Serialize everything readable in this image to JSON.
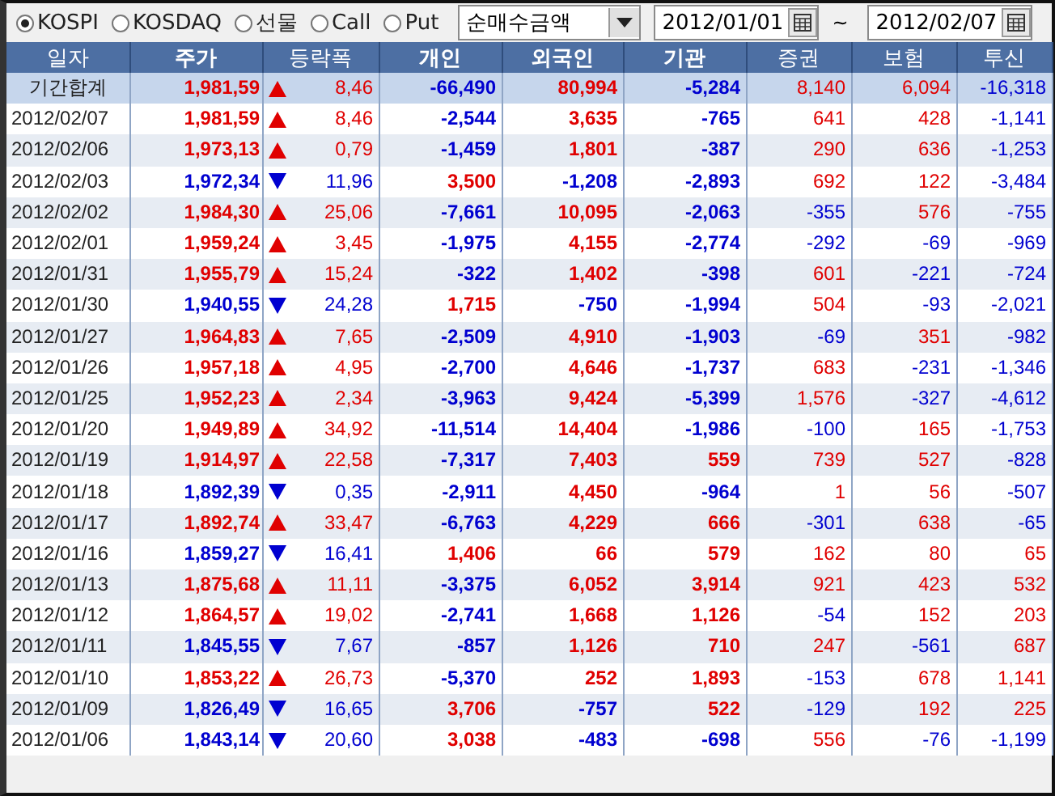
{
  "market_options": [
    {
      "label": "KOSPI",
      "selected": true
    },
    {
      "label": "KOSDAQ",
      "selected": false
    },
    {
      "label": "선물",
      "selected": false
    },
    {
      "label": "Call",
      "selected": false
    },
    {
      "label": "Put",
      "selected": false
    }
  ],
  "value_type": {
    "value": "순매수금액"
  },
  "date_from": {
    "value": "2012/01/01"
  },
  "date_range_separator": "~",
  "date_to": {
    "value": "2012/02/07"
  },
  "table": {
    "columns": [
      "일자",
      "주가",
      "등락폭",
      "개인",
      "외국인",
      "기관",
      "증권",
      "보험",
      "투신"
    ],
    "rows": [
      {
        "kind": "total",
        "rising": true,
        "cells": [
          "기간합계",
          "1,981,59",
          "8,46",
          "-66,490",
          "80,994",
          "-5,284",
          "8,140",
          "6,094",
          "-16,318"
        ]
      },
      {
        "kind": "day",
        "rising": true,
        "cells": [
          "2012/02/07",
          "1,981,59",
          "8,46",
          "-2,544",
          "3,635",
          "-765",
          "641",
          "428",
          "-1,141"
        ]
      },
      {
        "kind": "day",
        "rising": true,
        "cells": [
          "2012/02/06",
          "1,973,13",
          "0,79",
          "-1,459",
          "1,801",
          "-387",
          "290",
          "636",
          "-1,253"
        ]
      },
      {
        "kind": "day",
        "rising": false,
        "cells": [
          "2012/02/03",
          "1,972,34",
          "11,96",
          "3,500",
          "-1,208",
          "-2,893",
          "692",
          "122",
          "-3,484"
        ]
      },
      {
        "kind": "day",
        "rising": true,
        "cells": [
          "2012/02/02",
          "1,984,30",
          "25,06",
          "-7,661",
          "10,095",
          "-2,063",
          "-355",
          "576",
          "-755"
        ]
      },
      {
        "kind": "day",
        "rising": true,
        "cells": [
          "2012/02/01",
          "1,959,24",
          "3,45",
          "-1,975",
          "4,155",
          "-2,774",
          "-292",
          "-69",
          "-969"
        ]
      },
      {
        "kind": "day",
        "rising": true,
        "cells": [
          "2012/01/31",
          "1,955,79",
          "15,24",
          "-322",
          "1,402",
          "-398",
          "601",
          "-221",
          "-724"
        ]
      },
      {
        "kind": "day",
        "rising": false,
        "cells": [
          "2012/01/30",
          "1,940,55",
          "24,28",
          "1,715",
          "-750",
          "-1,994",
          "504",
          "-93",
          "-2,021"
        ]
      },
      {
        "kind": "day",
        "rising": true,
        "cells": [
          "2012/01/27",
          "1,964,83",
          "7,65",
          "-2,509",
          "4,910",
          "-1,903",
          "-69",
          "351",
          "-982"
        ]
      },
      {
        "kind": "day",
        "rising": true,
        "cells": [
          "2012/01/26",
          "1,957,18",
          "4,95",
          "-2,700",
          "4,646",
          "-1,737",
          "683",
          "-231",
          "-1,346"
        ]
      },
      {
        "kind": "day",
        "rising": true,
        "cells": [
          "2012/01/25",
          "1,952,23",
          "2,34",
          "-3,963",
          "9,424",
          "-5,399",
          "1,576",
          "-327",
          "-4,612"
        ]
      },
      {
        "kind": "day",
        "rising": true,
        "cells": [
          "2012/01/20",
          "1,949,89",
          "34,92",
          "-11,514",
          "14,404",
          "-1,986",
          "-100",
          "165",
          "-1,753"
        ]
      },
      {
        "kind": "day",
        "rising": true,
        "cells": [
          "2012/01/19",
          "1,914,97",
          "22,58",
          "-7,317",
          "7,403",
          "559",
          "739",
          "527",
          "-828"
        ]
      },
      {
        "kind": "day",
        "rising": false,
        "cells": [
          "2012/01/18",
          "1,892,39",
          "0,35",
          "-2,911",
          "4,450",
          "-964",
          "1",
          "56",
          "-507"
        ]
      },
      {
        "kind": "day",
        "rising": true,
        "cells": [
          "2012/01/17",
          "1,892,74",
          "33,47",
          "-6,763",
          "4,229",
          "666",
          "-301",
          "638",
          "-65"
        ]
      },
      {
        "kind": "day",
        "rising": false,
        "cells": [
          "2012/01/16",
          "1,859,27",
          "16,41",
          "1,406",
          "66",
          "579",
          "162",
          "80",
          "65"
        ]
      },
      {
        "kind": "day",
        "rising": true,
        "cells": [
          "2012/01/13",
          "1,875,68",
          "11,11",
          "-3,375",
          "6,052",
          "3,914",
          "921",
          "423",
          "532"
        ]
      },
      {
        "kind": "day",
        "rising": true,
        "cells": [
          "2012/01/12",
          "1,864,57",
          "19,02",
          "-2,741",
          "1,668",
          "1,126",
          "-54",
          "152",
          "203"
        ]
      },
      {
        "kind": "day",
        "rising": false,
        "cells": [
          "2012/01/11",
          "1,845,55",
          "7,67",
          "-857",
          "1,126",
          "710",
          "247",
          "-561",
          "687"
        ]
      },
      {
        "kind": "day",
        "rising": true,
        "cells": [
          "2012/01/10",
          "1,853,22",
          "26,73",
          "-5,370",
          "252",
          "1,893",
          "-153",
          "678",
          "1,141"
        ]
      },
      {
        "kind": "day",
        "rising": false,
        "cells": [
          "2012/01/09",
          "1,826,49",
          "16,65",
          "3,706",
          "-757",
          "522",
          "-129",
          "192",
          "225"
        ]
      },
      {
        "kind": "day",
        "rising": false,
        "cells": [
          "2012/01/06",
          "1,843,14",
          "20,60",
          "3,038",
          "-483",
          "-698",
          "556",
          "-76",
          "-1,199"
        ]
      }
    ]
  }
}
